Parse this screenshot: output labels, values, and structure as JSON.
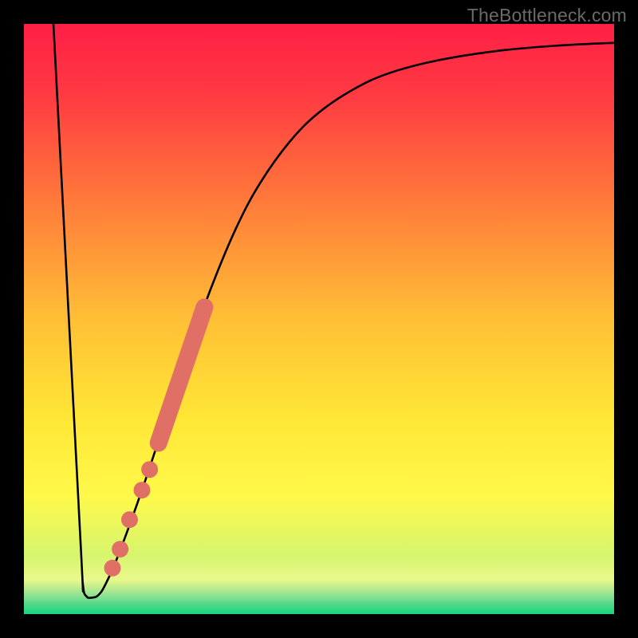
{
  "watermark": "TheBottleneck.com",
  "chart_data": {
    "type": "line",
    "title": "",
    "xlabel": "",
    "ylabel": "",
    "xlim": [
      0,
      100
    ],
    "ylim": [
      0,
      100
    ],
    "grid": false,
    "legend": false,
    "background_gradient": {
      "direction": "vertical",
      "stops": [
        {
          "pct": 0.0,
          "color": "#ff1f46"
        },
        {
          "pct": 0.12,
          "color": "#ff3a42"
        },
        {
          "pct": 0.3,
          "color": "#ff7a3a"
        },
        {
          "pct": 0.5,
          "color": "#ffbf36"
        },
        {
          "pct": 0.67,
          "color": "#ffe736"
        },
        {
          "pct": 0.8,
          "color": "#fff94a"
        },
        {
          "pct": 0.9,
          "color": "#d6f56e"
        },
        {
          "pct": 0.942,
          "color": "#e9f88a"
        },
        {
          "pct": 0.958,
          "color": "#b3ea8e"
        },
        {
          "pct": 0.971,
          "color": "#86e092"
        },
        {
          "pct": 0.984,
          "color": "#4fd888"
        },
        {
          "pct": 1.0,
          "color": "#14d77c"
        }
      ]
    },
    "series": [
      {
        "name": "curve",
        "stroke": "#000000",
        "stroke_width": 2.6,
        "points": [
          {
            "x": 5.0,
            "y": 100.0
          },
          {
            "x": 9.5,
            "y": 14.0
          },
          {
            "x": 10.0,
            "y": 5.0
          },
          {
            "x": 10.6,
            "y": 3.0
          },
          {
            "x": 11.6,
            "y": 2.8
          },
          {
            "x": 12.6,
            "y": 3.2
          },
          {
            "x": 13.8,
            "y": 5.0
          },
          {
            "x": 16.0,
            "y": 10.0
          },
          {
            "x": 20.0,
            "y": 21.0
          },
          {
            "x": 24.0,
            "y": 33.0
          },
          {
            "x": 28.0,
            "y": 45.0
          },
          {
            "x": 32.0,
            "y": 56.0
          },
          {
            "x": 36.0,
            "y": 65.5
          },
          {
            "x": 40.0,
            "y": 73.0
          },
          {
            "x": 45.0,
            "y": 80.0
          },
          {
            "x": 50.0,
            "y": 85.0
          },
          {
            "x": 56.0,
            "y": 89.0
          },
          {
            "x": 62.0,
            "y": 91.7
          },
          {
            "x": 70.0,
            "y": 93.8
          },
          {
            "x": 80.0,
            "y": 95.4
          },
          {
            "x": 90.0,
            "y": 96.3
          },
          {
            "x": 100.0,
            "y": 96.8
          }
        ]
      }
    ],
    "markers": {
      "color": "#e07066",
      "radius": 10.5,
      "single_points": [
        {
          "x": 17.9,
          "y": 16.0
        },
        {
          "x": 20.0,
          "y": 21.0
        },
        {
          "x": 21.3,
          "y": 24.5
        },
        {
          "x": 16.3,
          "y": 11.0
        },
        {
          "x": 15.0,
          "y": 7.8
        }
      ],
      "thick_segment": {
        "start": {
          "x": 22.8,
          "y": 29.0
        },
        "end": {
          "x": 30.6,
          "y": 52.0
        },
        "width": 22
      }
    }
  }
}
